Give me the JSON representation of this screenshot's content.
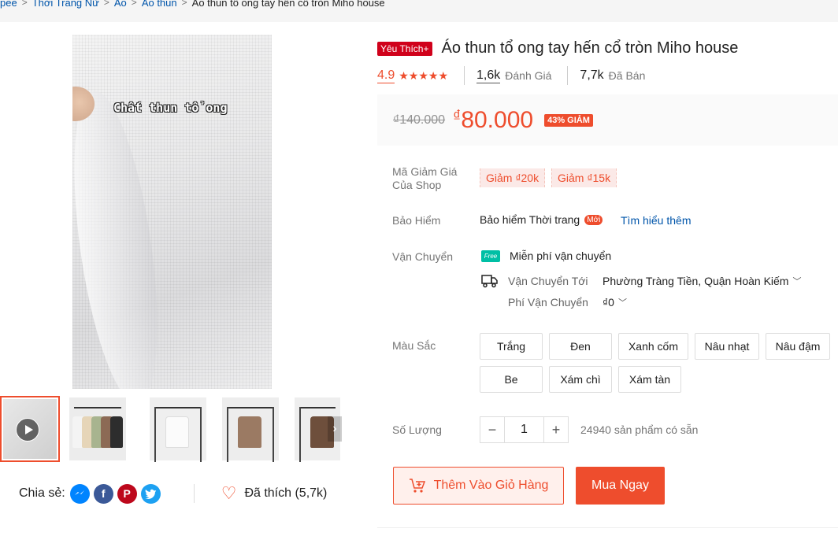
{
  "breadcrumb": [
    "pee",
    "Thời Trang Nữ",
    "Áo",
    "Áo thun",
    "Áo thun tổ ong tay hến cổ tròn Miho house"
  ],
  "gallery": {
    "caption": "Chất thun tổ ong",
    "thumbnails": [
      {
        "kind": "video",
        "active": true
      },
      {
        "kind": "photo",
        "shirt_color": "#d9c7b0"
      },
      {
        "kind": "photo",
        "shirt_color": "#f7f7f7"
      },
      {
        "kind": "photo",
        "shirt_color": "#9b7a63"
      },
      {
        "kind": "photo",
        "shirt_color": "#6e4f3c"
      }
    ]
  },
  "share": {
    "label": "Chia sẻ:",
    "icons": [
      "messenger-icon",
      "facebook-icon",
      "pinterest-icon",
      "twitter-icon"
    ],
    "liked_label": "Đã thích (5,7k)"
  },
  "product": {
    "badge": "Yêu Thích+",
    "title": "Áo thun tổ ong tay hến cổ tròn Miho house",
    "rating": "4.9",
    "reviews_count": "1,6k",
    "reviews_label": "Đánh Giá",
    "sold_count": "7,7k",
    "sold_label": "Đã Bán"
  },
  "price": {
    "original": "₫140.000",
    "currency": "₫",
    "current": "80.000",
    "discount": "43% GIẢM"
  },
  "vouchers": {
    "label": "Mã Giảm Giá Của Shop",
    "items": [
      "Giảm ₫20k",
      "Giảm ₫15k"
    ]
  },
  "insurance": {
    "label": "Bảo Hiểm",
    "value": "Bảo hiểm Thời trang",
    "new_badge": "Mới",
    "link": "Tìm hiểu thêm"
  },
  "shipping": {
    "label": "Vận Chuyển",
    "free_badge": "Free",
    "free_text": "Miễn phí vận chuyển",
    "to_label": "Vận Chuyển Tới",
    "to_value": "Phường Tràng Tiền, Quận Hoàn Kiếm",
    "fee_label": "Phí Vận Chuyển",
    "fee_value": "₫0"
  },
  "colors": {
    "label": "Màu Sắc",
    "options": [
      "Trắng",
      "Đen",
      "Xanh cốm",
      "Nâu nhạt",
      "Nâu đậm",
      "Be",
      "Xám chì",
      "Xám tàn"
    ]
  },
  "quantity": {
    "label": "Số Lượng",
    "minus": "−",
    "value": "1",
    "plus": "+",
    "stock": "24940 sản phẩm có sẵn"
  },
  "actions": {
    "add_to_cart": "Thêm Vào Giỏ Hàng",
    "buy_now": "Mua Ngay"
  },
  "colors_theme": {
    "accent": "#ee4d2d",
    "link": "#0055aa"
  }
}
